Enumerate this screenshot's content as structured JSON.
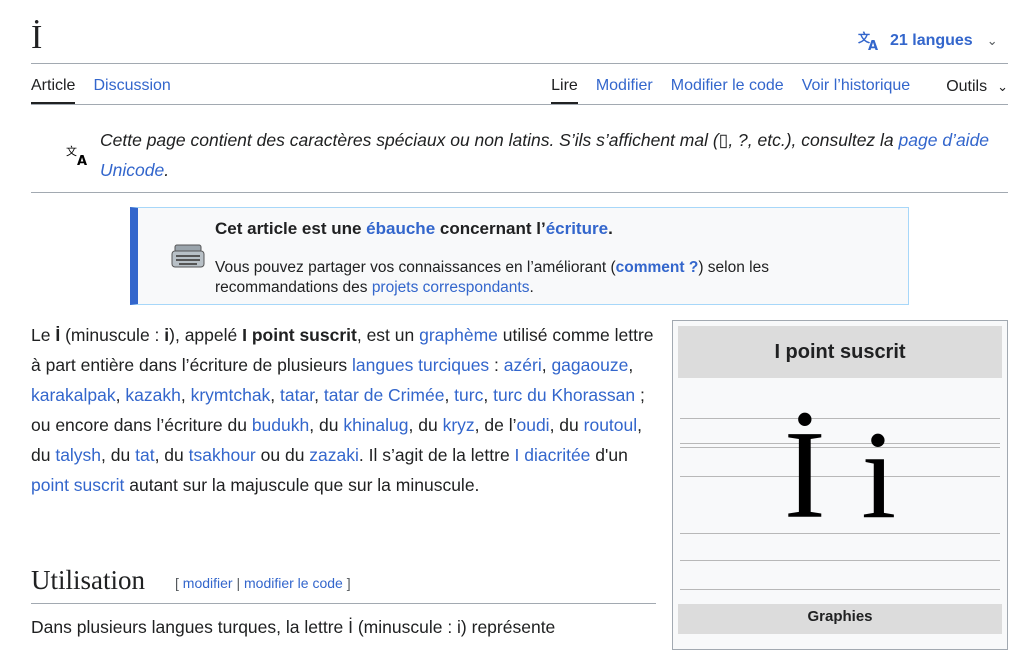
{
  "page": {
    "title": "İ",
    "languages_label": "21 langues"
  },
  "tabs": {
    "article": "Article",
    "discussion": "Discussion",
    "read": "Lire",
    "edit": "Modifier",
    "edit_source": "Modifier le code",
    "history": "Voir l’historique",
    "tools": "Outils"
  },
  "notice": {
    "text_before": "Cette page contient des caractères spéciaux ou non latins. S’ils s’affichent mal (",
    "box_char": "▯",
    "text_mid": ", ?, etc.), consultez la ",
    "link": "page d’aide Unicode",
    "text_after": "."
  },
  "ebauche": {
    "t1": "Cet article est une ",
    "link1": "ébauche",
    "t2": " concernant l’",
    "link2": "écriture",
    "t3": ".",
    "b1": "Vous pouvez partager vos connaissances en l’améliorant (",
    "blink1": "comment ?",
    "b2": ") selon les recommandations des ",
    "blink2": "projets correspondants",
    "b3": "."
  },
  "lead": {
    "p1": "Le ",
    "upper": "İ",
    "p2": " (minuscule : ",
    "lower": "i",
    "p3": "), appelé ",
    "name": "I point suscrit",
    "p4": ", est un ",
    "l_grapheme": "graphème",
    "p5": " utilisé comme lettre à part entière dans l’écriture de plusieurs ",
    "l_turciques": "langues turciques",
    "p6": " : ",
    "l_azeri": "azéri",
    "l_gagaouze": "gagaouze",
    "l_karakalpak": "karakalpak",
    "l_kazakh": "kazakh",
    "l_krymtchak": "krymtchak",
    "l_tatar": "tatar",
    "l_tatar_crimee": "tatar de Crimée",
    "l_turc": "turc",
    "l_turc_khor": "turc du Khorassan",
    "p7": " ; ou encore dans l’écriture du ",
    "l_budukh": "budukh",
    "l_khinalug": "khinalug",
    "l_kryz": "kryz",
    "l_oudi": "oudi",
    "l_routoul": "routoul",
    "l_talysh": "talysh",
    "l_tat": "tat",
    "l_tsakhour": "tsakhour",
    "l_zazaki": "zazaki",
    "p8": ". Il s’agit de la lettre ",
    "l_i_diacritee": "I diacritée",
    "p9": " d'un ",
    "l_point_suscrit": "point suscrit",
    "p10": " autant sur la majuscule que sur la minuscule.",
    "sep_comma": ", ",
    "sep_du": ", du ",
    "sep_de": ", de l’",
    "sep_ou_du": " ou du "
  },
  "infobox": {
    "title": "I point suscrit",
    "glyphs": "İ i",
    "section": "Graphies"
  },
  "section": {
    "heading": "Utilisation",
    "bracket_open": "[ ",
    "edit": "modifier",
    "sep": " | ",
    "edit_source": "modifier le code",
    "bracket_close": " ]",
    "next_line": "Dans plusieurs langues turques, la lettre İ (minuscule : i) représente"
  },
  "colors": {
    "link": "#3366cc",
    "text": "#202122",
    "accent_border": "#3366cc"
  },
  "icons": [
    "translate-icon",
    "chevron-down-icon",
    "typewriter-icon"
  ]
}
